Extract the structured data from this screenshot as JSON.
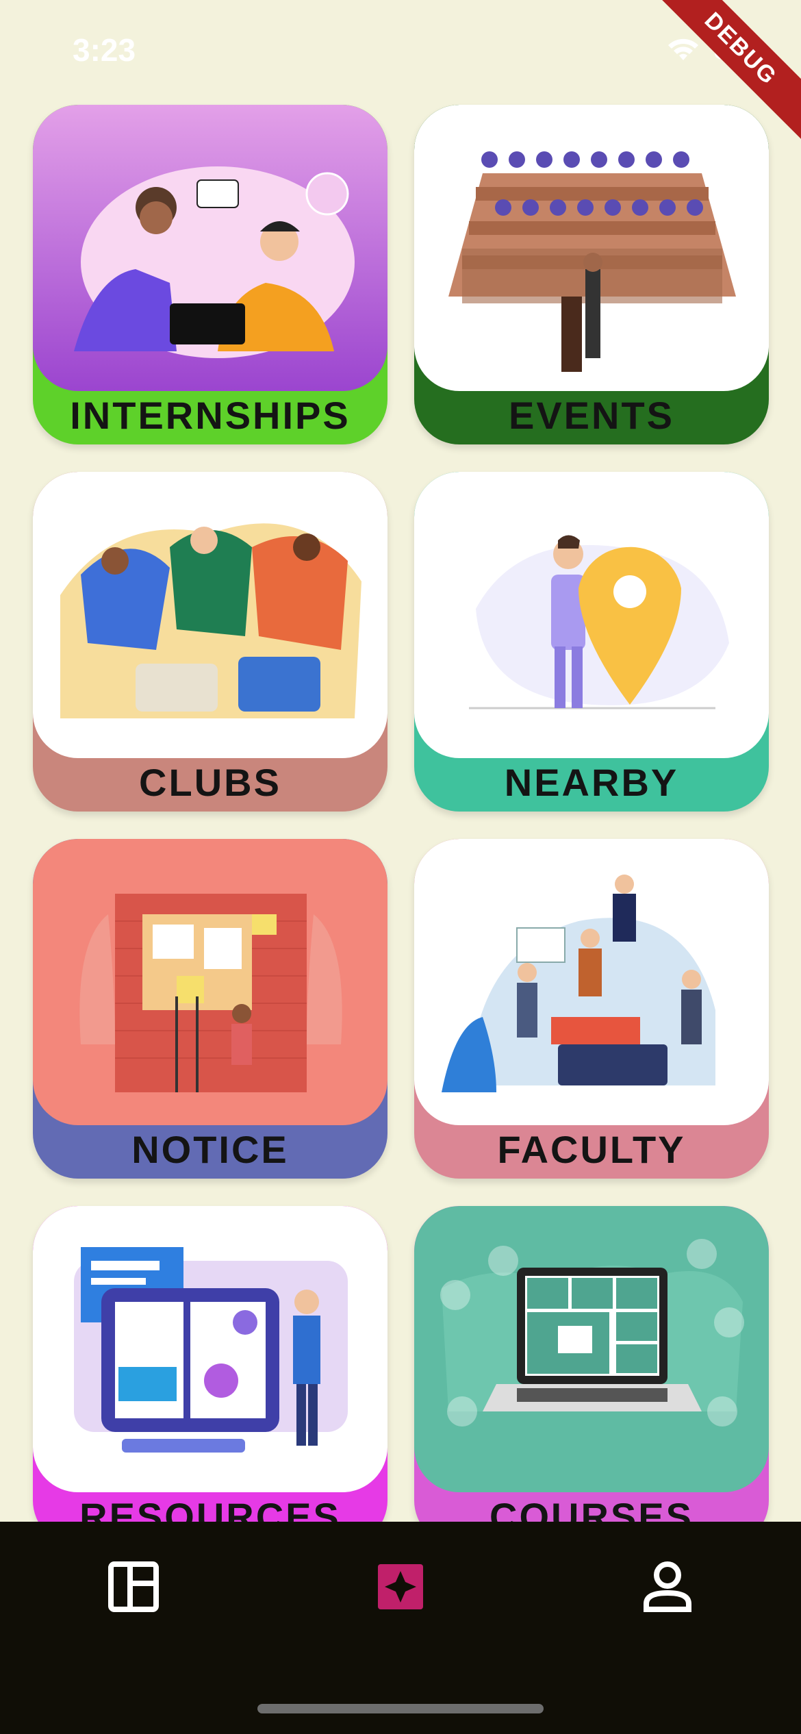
{
  "status_bar": {
    "time": "3:23",
    "debug_label": "DEBUG"
  },
  "cards": [
    {
      "label": "INTERNSHIPS",
      "bg": "#5ed12a",
      "image_bg": "#b565d9"
    },
    {
      "label": "EVENTS",
      "bg": "#256e1f",
      "image_bg": "#ffffff"
    },
    {
      "label": "CLUBS",
      "bg": "#c9867c",
      "image_bg": "#ffffff"
    },
    {
      "label": "NEARBY",
      "bg": "#3fc29d",
      "image_bg": "#ffffff"
    },
    {
      "label": "NOTICE",
      "bg": "#626bb4",
      "image_bg": "#f3877b"
    },
    {
      "label": "FACULTY",
      "bg": "#db8694",
      "image_bg": "#ffffff"
    },
    {
      "label": "RESOURCES",
      "bg": "#e63ae6",
      "image_bg": "#ffffff"
    },
    {
      "label": "COURSES",
      "bg": "#d95bd6",
      "image_bg": "#5fbba3"
    }
  ],
  "bottom_nav": {
    "items": [
      {
        "icon": "dashboard-icon",
        "color": "#ffffff"
      },
      {
        "icon": "puzzle-icon",
        "color": "#c0206a"
      },
      {
        "icon": "profile-icon",
        "color": "#ffffff"
      }
    ]
  }
}
